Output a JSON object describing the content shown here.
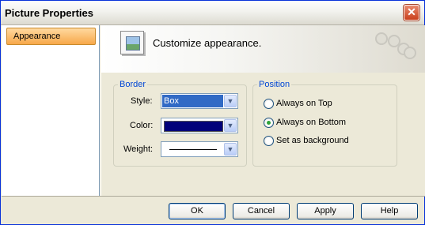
{
  "window": {
    "title": "Picture Properties"
  },
  "sidebar": {
    "items": [
      {
        "label": "Appearance"
      }
    ]
  },
  "header": {
    "text": "Customize appearance."
  },
  "border": {
    "legend": "Border",
    "style_label": "Style:",
    "style_value": "Box",
    "color_label": "Color:",
    "color_value": "#00007a",
    "weight_label": "Weight:"
  },
  "position": {
    "legend": "Position",
    "options": [
      {
        "label": "Always on Top",
        "checked": false
      },
      {
        "label": "Always on Bottom",
        "checked": true
      },
      {
        "label": "Set as background",
        "checked": false
      }
    ]
  },
  "buttons": {
    "ok": "OK",
    "cancel": "Cancel",
    "apply": "Apply",
    "help": "Help"
  },
  "icons": {
    "close": "close-icon",
    "picture": "picture-icon",
    "dropdown": "chevron-down-icon",
    "gears": "gear-icon"
  }
}
